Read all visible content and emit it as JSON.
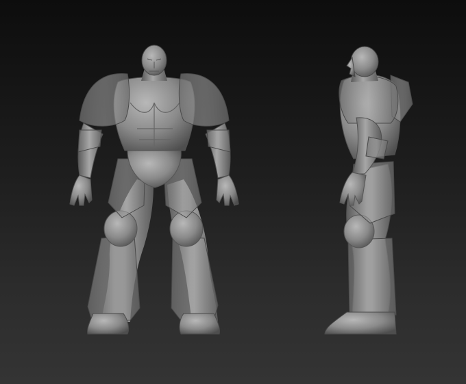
{
  "scene": {
    "views": [
      {
        "name": "front",
        "icon": "armored-figure-front-view"
      },
      {
        "name": "side",
        "icon": "armored-figure-side-view"
      }
    ],
    "colors": {
      "background_top": "#0d0d0d",
      "background_bottom": "#343434",
      "clay": "#8f8f8f",
      "clay_dark": "#5e5e5e",
      "armor_shell": "#9a9a9a"
    }
  }
}
